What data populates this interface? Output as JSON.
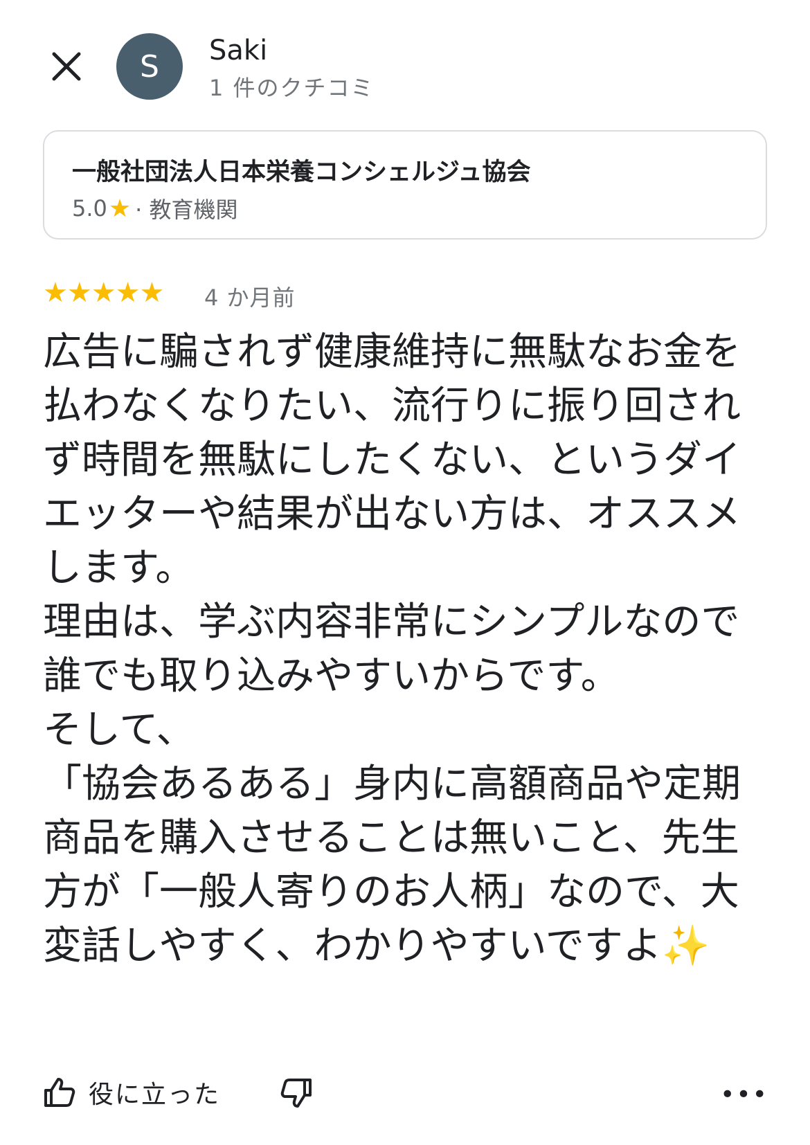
{
  "header": {
    "close_icon": "close-icon",
    "avatar_letter": "S",
    "user_name": "Saki",
    "review_count": "1 件のクチコミ"
  },
  "place": {
    "name": "一般社団法人日本栄養コンシェルジュ協会",
    "rating": "5.0",
    "category": "· 教育機関"
  },
  "review": {
    "stars": "★★★★★",
    "rating_value": 5,
    "time_ago": "4 か月前",
    "text": "広告に騙されず健康維持に無駄なお金を払わなくなりたい、流行りに振り回されず時間を無駄にしたくない、というダイエッターや結果が出ない方は、オススメします。\n理由は、学ぶ内容非常にシンプルなので誰でも取り込みやすいからです。\nそして、\n「協会あるある」身内に高額商品や定期商品を購入させることは無いこと、先生方が「一般人寄りのお人柄」なので、大変話しやすく、わかりやすいですよ✨"
  },
  "actions": {
    "helpful_label": "役に立った",
    "more_label": "•••"
  },
  "colors": {
    "star": "#fbbc04",
    "avatar_bg": "#4a5f6e",
    "secondary_text": "#70757a",
    "card_border": "#dadce0"
  }
}
